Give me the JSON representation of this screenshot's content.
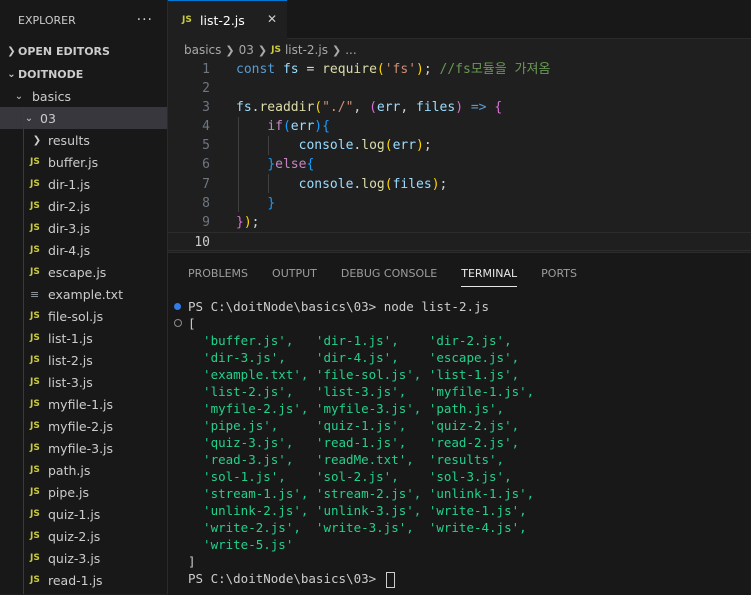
{
  "explorer": {
    "title": "EXPLORER",
    "more": "···",
    "open_editors": "OPEN EDITORS",
    "workspace": "DOITNODE",
    "folders": {
      "basics": "basics",
      "sub": "03",
      "results": "results"
    },
    "files": [
      {
        "name": "buffer.js",
        "type": "js"
      },
      {
        "name": "dir-1.js",
        "type": "js"
      },
      {
        "name": "dir-2.js",
        "type": "js"
      },
      {
        "name": "dir-3.js",
        "type": "js"
      },
      {
        "name": "dir-4.js",
        "type": "js"
      },
      {
        "name": "escape.js",
        "type": "js"
      },
      {
        "name": "example.txt",
        "type": "txt"
      },
      {
        "name": "file-sol.js",
        "type": "js"
      },
      {
        "name": "list-1.js",
        "type": "js"
      },
      {
        "name": "list-2.js",
        "type": "js"
      },
      {
        "name": "list-3.js",
        "type": "js"
      },
      {
        "name": "myfile-1.js",
        "type": "js"
      },
      {
        "name": "myfile-2.js",
        "type": "js"
      },
      {
        "name": "myfile-3.js",
        "type": "js"
      },
      {
        "name": "path.js",
        "type": "js"
      },
      {
        "name": "pipe.js",
        "type": "js"
      },
      {
        "name": "quiz-1.js",
        "type": "js"
      },
      {
        "name": "quiz-2.js",
        "type": "js"
      },
      {
        "name": "quiz-3.js",
        "type": "js"
      },
      {
        "name": "read-1.js",
        "type": "js"
      }
    ]
  },
  "editor": {
    "tab_label": "list-2.js",
    "tab_icon": "JS",
    "tab_close": "✕",
    "breadcrumb": [
      "basics",
      "03",
      "list-2.js",
      "..."
    ],
    "line_numbers": [
      "1",
      "2",
      "3",
      "4",
      "5",
      "6",
      "7",
      "8",
      "9",
      "10"
    ],
    "active_line": "10"
  },
  "panel": {
    "tabs": [
      "PROBLEMS",
      "OUTPUT",
      "DEBUG CONSOLE",
      "TERMINAL",
      "PORTS"
    ],
    "active_tab": "TERMINAL",
    "prompt": "PS C:\\doitNode\\basics\\03>",
    "command": "node list-2.js",
    "open_bracket": "[",
    "close_bracket": "]",
    "output_rows": [
      "  'buffer.js',   'dir-1.js',    'dir-2.js',",
      "  'dir-3.js',    'dir-4.js',    'escape.js',",
      "  'example.txt', 'file-sol.js', 'list-1.js',",
      "  'list-2.js',   'list-3.js',   'myfile-1.js',",
      "  'myfile-2.js', 'myfile-3.js', 'path.js',",
      "  'pipe.js',     'quiz-1.js',   'quiz-2.js',",
      "  'quiz-3.js',   'read-1.js',   'read-2.js',",
      "  'read-3.js',   'readMe.txt',  'results',",
      "  'sol-1.js',    'sol-2.js',    'sol-3.js',",
      "  'stream-1.js', 'stream-2.js', 'unlink-1.js',",
      "  'unlink-2.js', 'unlink-3.js', 'write-1.js',",
      "  'write-2.js',  'write-3.js',  'write-4.js',",
      "  'write-5.js'"
    ],
    "final_prompt": "PS C:\\doitNode\\basics\\03>"
  },
  "colors": {
    "accent": "#0078d4",
    "terminal_strings": "#23d18b",
    "success_dot": "#2e7de9"
  }
}
